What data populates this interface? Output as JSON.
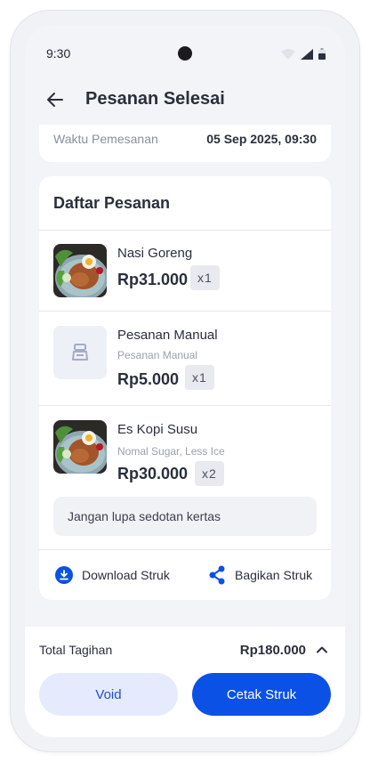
{
  "status_bar": {
    "time": "9:30"
  },
  "header": {
    "title": "Pesanan Selesai"
  },
  "order_info": {
    "label": "Waktu Pemesanan",
    "value": "05 Sep 2025, 09:30"
  },
  "orders": {
    "title": "Daftar Pesanan",
    "items": [
      {
        "name": "Nasi Goreng",
        "note": "",
        "price": "Rp31.000",
        "qty": "x1"
      },
      {
        "name": "Pesanan Manual",
        "note": "Pesanan Manual",
        "price": "Rp5.000",
        "qty": "x1"
      },
      {
        "name": "Es Kopi Susu",
        "note": "Nomal Sugar, Less Ice",
        "price": "Rp30.000",
        "qty": "x2"
      }
    ],
    "order_note": "Jangan lupa sedotan kertas",
    "actions": {
      "download": "Download Struk",
      "share": "Bagikan Struk"
    }
  },
  "footer": {
    "total_label": "Total Tagihan",
    "total_value": "Rp180.000",
    "void_label": "Void",
    "print_label": "Cetak Struk"
  },
  "colors": {
    "primary": "#0b51e6",
    "secondary_bg": "#e5eafc"
  },
  "icons": [
    "back-arrow-icon",
    "wifi-icon",
    "signal-icon",
    "battery-icon",
    "cash-register-icon",
    "download-icon",
    "share-icon",
    "chevron-up-icon"
  ]
}
